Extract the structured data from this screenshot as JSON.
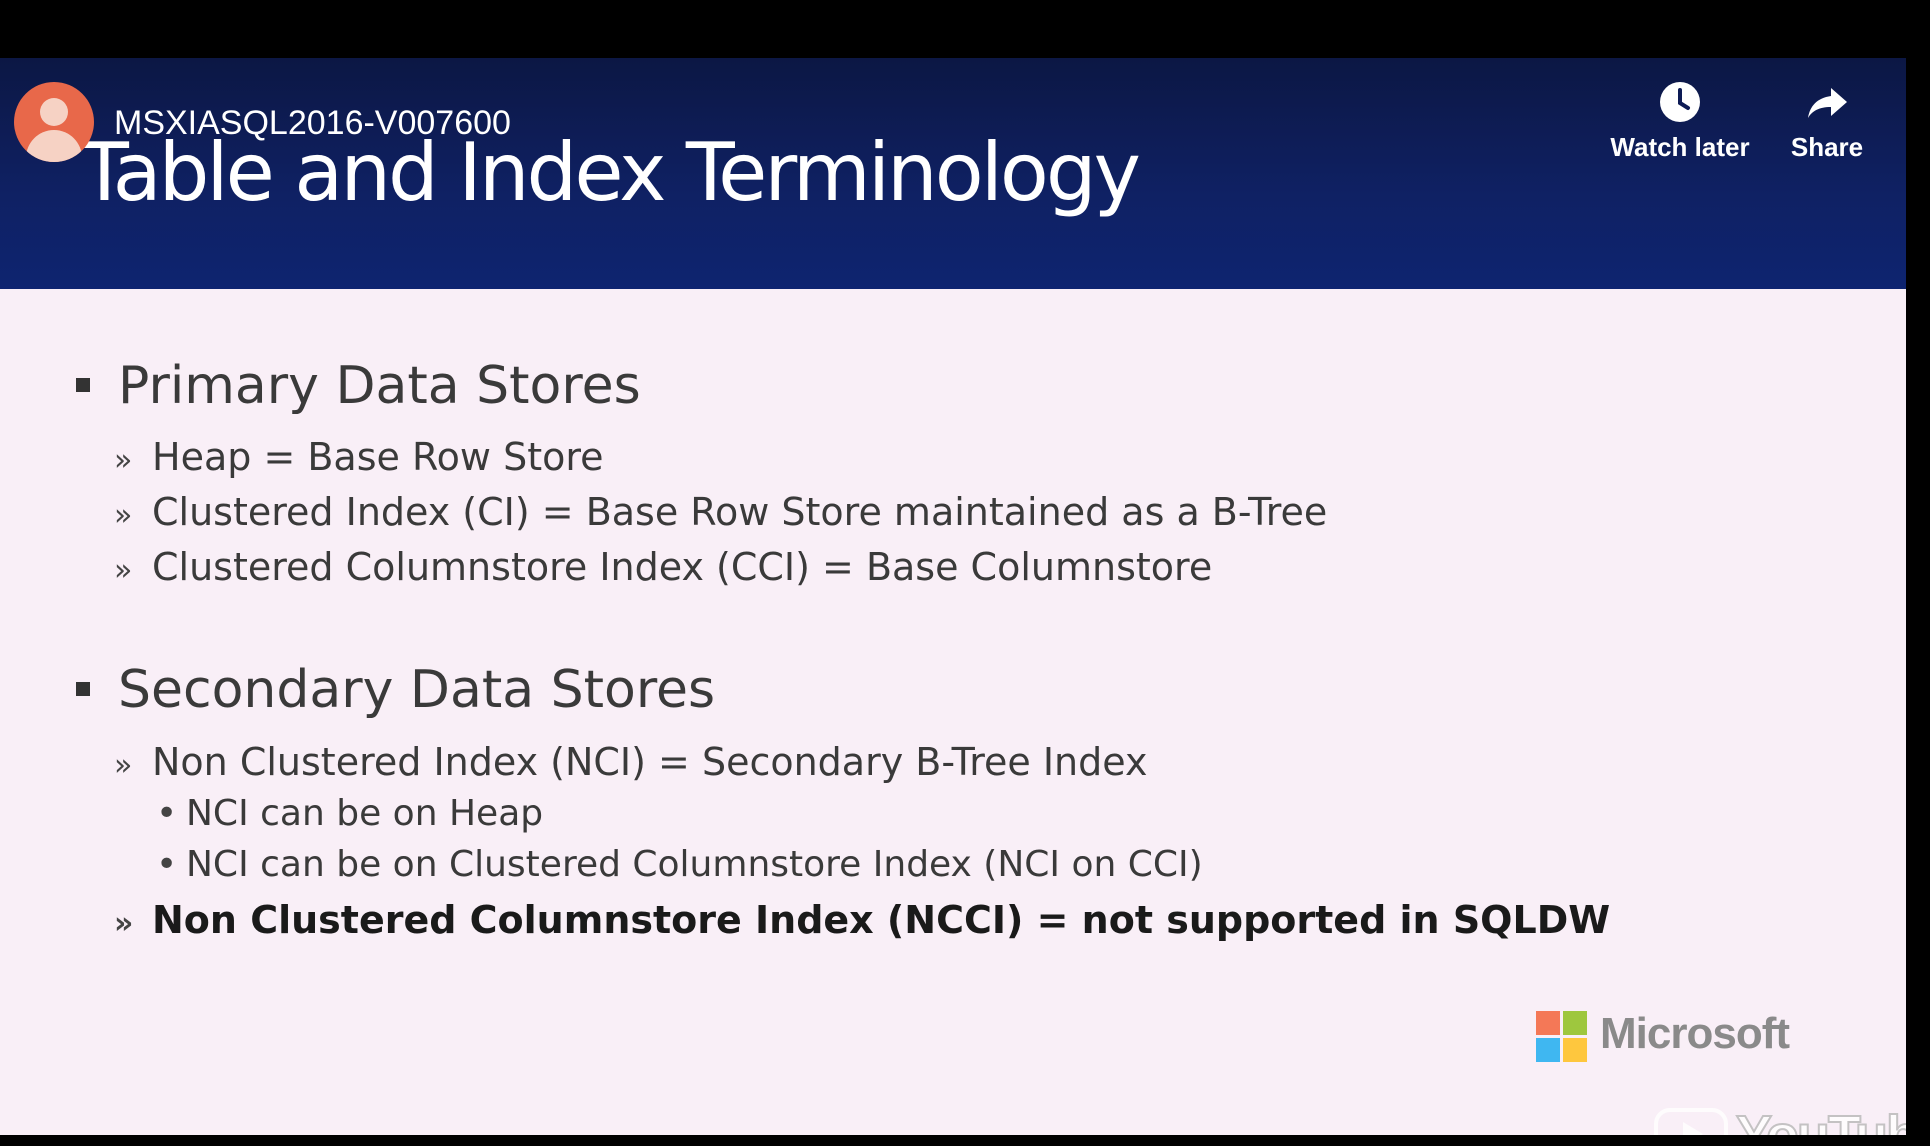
{
  "video": {
    "title": "MSXIASQL2016-V007600",
    "actions": {
      "watch_later": "Watch later",
      "share": "Share"
    },
    "watermark": "YouTube"
  },
  "slide": {
    "title": "Table and Index Terminology",
    "sections": [
      {
        "heading": "Primary Data Stores",
        "items": [
          "Heap = Base Row Store",
          "Clustered Index (CI) = Base Row Store maintained as a B-Tree",
          "Clustered Columnstore Index (CCI) = Base Columnstore"
        ]
      },
      {
        "heading": "Secondary Data Stores",
        "items": [
          "Non Clustered Index (NCI) = Secondary B-Tree Index",
          "Non Clustered Columnstore Index (NCCI) = not supported in SQLDW"
        ],
        "subitems": [
          "NCI can be on Heap",
          "NCI can be on Clustered Columnstore Index (NCI on CCI)"
        ]
      }
    ],
    "logo_text": "Microsoft",
    "bullet_glyph": "»",
    "dot_glyph": "•"
  },
  "colors": {
    "header_bg": "#0e1e5e",
    "slide_bg": "#f9eff7",
    "avatar": "#e8684a"
  },
  "icons": [
    "person-avatar-icon",
    "clock-icon",
    "share-arrow-icon",
    "youtube-play-icon",
    "microsoft-logo-icon"
  ]
}
